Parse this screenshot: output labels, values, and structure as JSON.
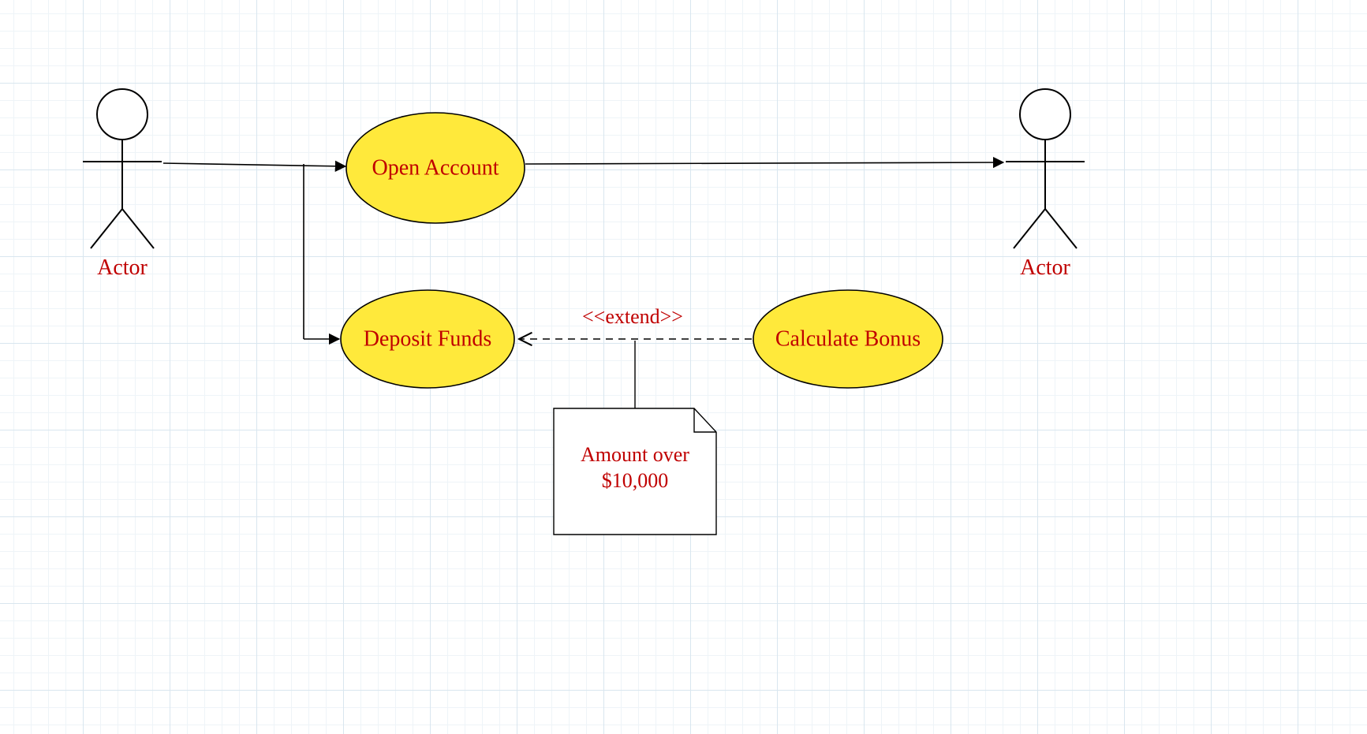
{
  "actors": {
    "left": {
      "label": "Actor"
    },
    "right": {
      "label": "Actor"
    }
  },
  "usecases": {
    "open_account": {
      "label": "Open Account"
    },
    "deposit_funds": {
      "label": "Deposit Funds"
    },
    "calculate_bonus": {
      "label": "Calculate Bonus"
    }
  },
  "relations": {
    "extend_stereotype": "<<extend>>"
  },
  "note": {
    "line1": "Amount over",
    "line2": "$10,000"
  }
}
